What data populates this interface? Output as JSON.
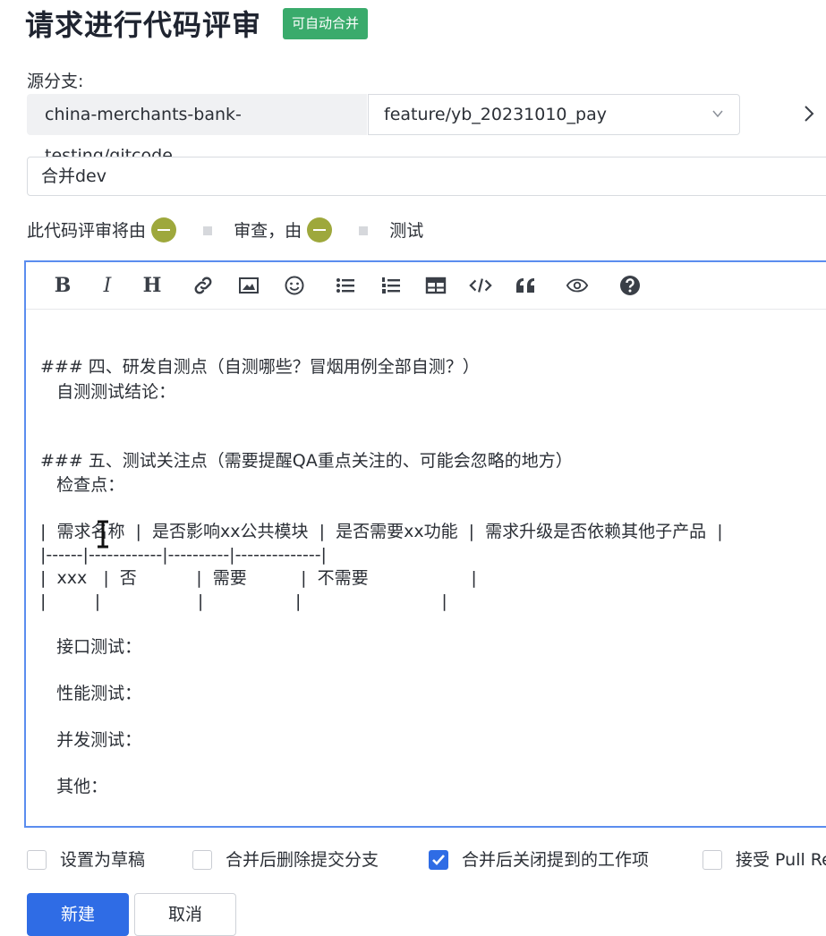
{
  "header": {
    "title": "请求进行代码评审",
    "badge": "可自动合并"
  },
  "source": {
    "label": "源分支:",
    "repo": "china-merchants-bank-testing/gitcode",
    "branch": "feature/yb_20231010_pay"
  },
  "mr_title": {
    "value": "合并dev"
  },
  "reviewers": {
    "prefix": "此代码评审将由",
    "middle": "审查，由",
    "suffix": "测试"
  },
  "toolbar": {
    "icons": [
      "bold-icon",
      "italic-icon",
      "heading-icon",
      "link-icon",
      "image-icon",
      "emoji-icon",
      "bullet-list-icon",
      "numbered-list-icon",
      "table-icon",
      "code-icon",
      "quote-icon",
      "preview-eye-icon",
      "help-icon"
    ]
  },
  "editor": {
    "lines": [
      "### 四、研发自测点（自测哪些？冒烟用例全部自测？）",
      "   自测测试结论：",
      "### 五、测试关注点（需要提醒QA重点关注的、可能会忽略的地方）",
      "   检查点：",
      "|  需求名称  |  是否影响xx公共模块  |  是否需要xx功能  |  需求升级是否依赖其他子产品  |",
      "|------|------------|----------|--------------|",
      "|  xxx   |  否           |  需要          |  不需要                   |",
      "|         |                  |                 |                          |",
      "   接口测试：",
      "   性能测试：",
      "   并发测试：",
      "   其他："
    ]
  },
  "options": [
    {
      "label": "设置为草稿",
      "checked": false
    },
    {
      "label": "合并后删除提交分支",
      "checked": false
    },
    {
      "label": "合并后关闭提到的工作项",
      "checked": true
    },
    {
      "label": "接受 Pull Re",
      "checked": false
    }
  ],
  "actions": {
    "create": "新建",
    "cancel": "取消"
  },
  "colors": {
    "primary": "#2f6ce5",
    "badge": "#3aab6c",
    "avatar": "#9ea83c",
    "editor_border": "#5b8def"
  }
}
